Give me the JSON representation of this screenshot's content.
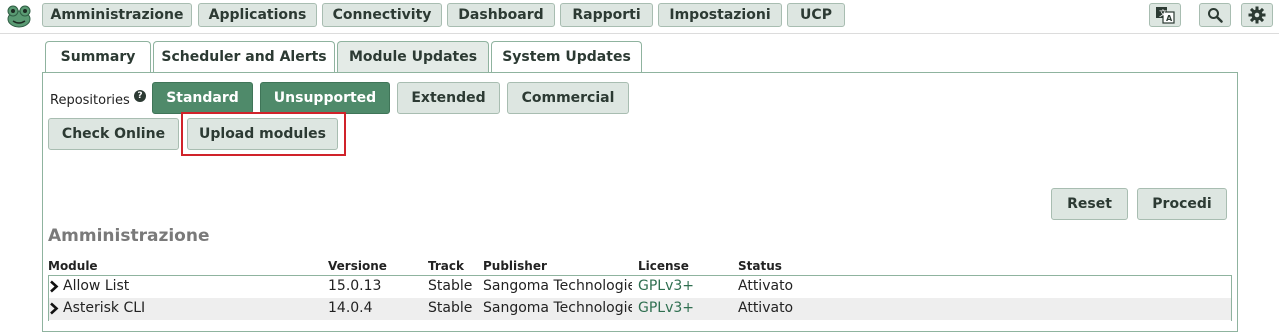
{
  "topnav": {
    "items": [
      "Amministrazione",
      "Applications",
      "Connectivity",
      "Dashboard",
      "Rapporti",
      "Impostazioni",
      "UCP"
    ],
    "icons": [
      "translate-icon",
      "search-icon",
      "gear-icon"
    ]
  },
  "tabs": [
    {
      "label": "Summary",
      "active": false
    },
    {
      "label": "Scheduler and Alerts",
      "active": false
    },
    {
      "label": "Module Updates",
      "active": true
    },
    {
      "label": "System Updates",
      "active": false
    }
  ],
  "repositories": {
    "label": "Repositories",
    "help": "?",
    "buttons": [
      {
        "label": "Standard",
        "selected": true
      },
      {
        "label": "Unsupported",
        "selected": true
      },
      {
        "label": "Extended",
        "selected": false
      },
      {
        "label": "Commercial",
        "selected": false
      }
    ]
  },
  "actions": {
    "check_online": "Check Online",
    "upload_modules": "Upload modules",
    "reset": "Reset",
    "procedi": "Procedi"
  },
  "section": {
    "title": "Amministrazione",
    "columns": [
      "Module",
      "Versione",
      "Track",
      "Publisher",
      "License",
      "Status"
    ],
    "rows": [
      {
        "module": "Allow List",
        "version": "15.0.13",
        "track": "Stable",
        "publisher": "Sangoma Technologies",
        "license": "GPLv3+",
        "status": "Attivato"
      },
      {
        "module": "Asterisk CLI",
        "version": "14.0.4",
        "track": "Stable",
        "publisher": "Sangoma Technologies",
        "license": "GPLv3+",
        "status": "Attivato"
      }
    ]
  },
  "colors": {
    "accent": "#4f8a6a",
    "button_bg": "#dde6e1",
    "border": "#8fb39f",
    "highlight": "#d0232a"
  }
}
